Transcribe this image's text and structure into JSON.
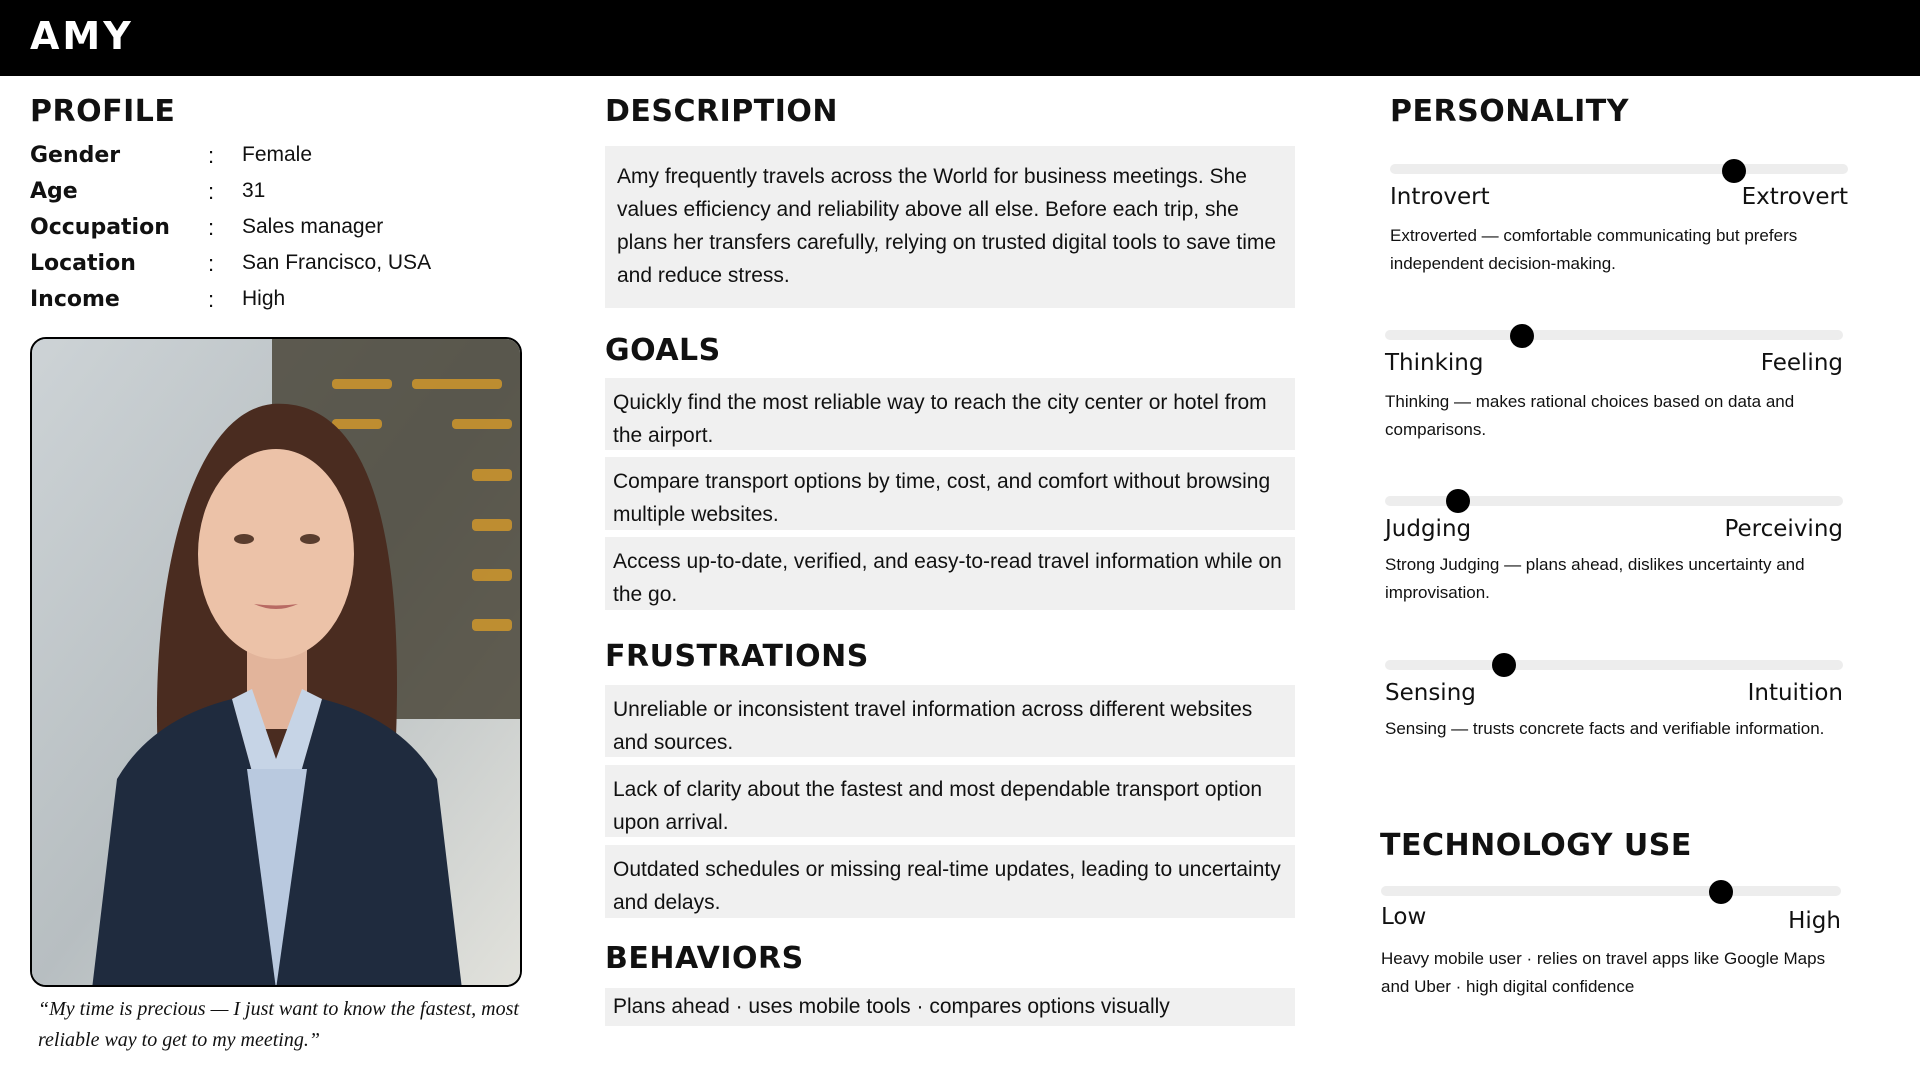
{
  "persona": {
    "name": "AMY"
  },
  "profile": {
    "heading": "PROFILE",
    "rows": [
      {
        "label": "Gender",
        "colon": ":",
        "value": "Female"
      },
      {
        "label": "Age",
        "colon": ":",
        "value": "31"
      },
      {
        "label": "Occupation",
        "colon": ":",
        "value": "Sales manager"
      },
      {
        "label": "Location",
        "colon": ":",
        "value": "San Francisco, USA"
      },
      {
        "label": "Income",
        "colon": ":",
        "value": "High"
      }
    ],
    "quote": "“My time is precious — I just want to know the fastest, most reliable way to get to my meeting.”"
  },
  "description": {
    "heading": "DESCRIPTION",
    "text": "Amy frequently travels across the World for business meetings. She values efficiency and reliability above all else. Before each trip, she plans her transfers carefully, relying on trusted digital tools to save time and reduce stress."
  },
  "goals": {
    "heading": "GOALS",
    "items": [
      "Quickly find the most reliable way to reach the city center or hotel from the airport.",
      "Compare transport options by time, cost, and comfort without browsing multiple websites.",
      "Access up-to-date, verified, and easy-to-read travel information while on the go."
    ]
  },
  "frustrations": {
    "heading": "FRUSTRATIONS",
    "items": [
      "Unreliable or inconsistent travel information across different websites and sources.",
      "Lack of clarity about the fastest and most dependable transport option upon arrival.",
      "Outdated schedules or missing real-time updates, leading to uncertainty and delays."
    ]
  },
  "behaviors": {
    "heading": "BEHAVIORS",
    "text": "Plans ahead · uses mobile tools · compares options visually"
  },
  "personality": {
    "heading": "PERSONALITY",
    "traits": [
      {
        "left": "Introvert",
        "right": "Extrovert",
        "level": 0.75,
        "desc": "Extroverted — comfortable communicating but prefers independent decision-making."
      },
      {
        "left": "Thinking",
        "right": "Feeling",
        "level": 0.3,
        "desc": "Thinking — makes rational choices based on data and comparisons."
      },
      {
        "left": "Judging",
        "right": "Perceiving",
        "level": 0.16,
        "desc": "Strong Judging — plans ahead, dislikes uncertainty and improvisation."
      },
      {
        "left": "Sensing",
        "right": "Intuition",
        "level": 0.26,
        "desc": "Sensing — trusts concrete facts and verifiable information."
      }
    ]
  },
  "technology": {
    "heading": "TECHNOLOGY USE",
    "left": "Low",
    "right": "High",
    "level": 0.74,
    "desc": "Heavy mobile user · relies on travel apps like Google Maps and Uber · high digital confidence"
  }
}
